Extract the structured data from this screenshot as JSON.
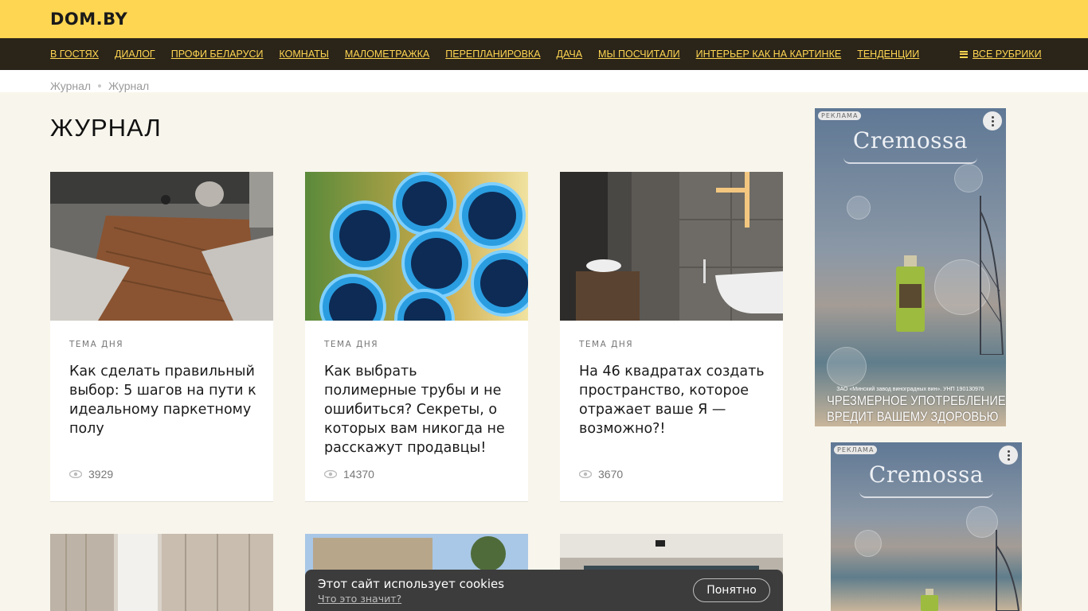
{
  "site": {
    "logo": "DOM.BY"
  },
  "nav": {
    "items": [
      {
        "label": "В гостях"
      },
      {
        "label": "Диалог"
      },
      {
        "label": "Профи Беларуси"
      },
      {
        "label": "Комнаты"
      },
      {
        "label": "Малометражка"
      },
      {
        "label": "Перепланировка"
      },
      {
        "label": "Дача"
      },
      {
        "label": "Мы посчитали"
      },
      {
        "label": "Интерьер как на картинке"
      },
      {
        "label": "Тенденции"
      }
    ],
    "all_rubrics": "Все рубрики"
  },
  "breadcrumbs": [
    "Журнал",
    "Журнал"
  ],
  "page_title": "ЖУРНАЛ",
  "cards": [
    {
      "tag": "Тема дня",
      "title": "Как сделать правильный выбор: 5 шагов на пути к идеальному паркетному полу",
      "views": "3929"
    },
    {
      "tag": "Тема дня",
      "title": "Как выбрать полимерные трубы и не ошибиться? Секреты, о которых вам никогда не расскажут продавцы!",
      "views": "14370"
    },
    {
      "tag": "Тема дня",
      "title": "На 46 квадратах создать пространство, которое отражает ваше Я — возможно?!",
      "views": "3670"
    }
  ],
  "ads": [
    {
      "label": "РЕКЛАМА",
      "brand": "Cremossa",
      "fine_print": "ЗАО «Минский завод виноградных вин». УНП 190130976",
      "warning_1": "ЧРЕЗМЕРНОЕ УПОТРЕБЛЕНИЕ АЛКОГОЛЯ",
      "warning_2": "ВРЕДИТ ВАШЕМУ ЗДОРОВЬЮ"
    },
    {
      "label": "РЕКЛАМА",
      "brand": "Cremossa"
    }
  ],
  "cookie": {
    "text": "Этот сайт использует cookies",
    "link": "Что это значит?",
    "button": "Понятно"
  },
  "colors": {
    "accent": "#ffd652",
    "nav_bg": "#2a2419",
    "page_bg": "#f8f5ec"
  }
}
